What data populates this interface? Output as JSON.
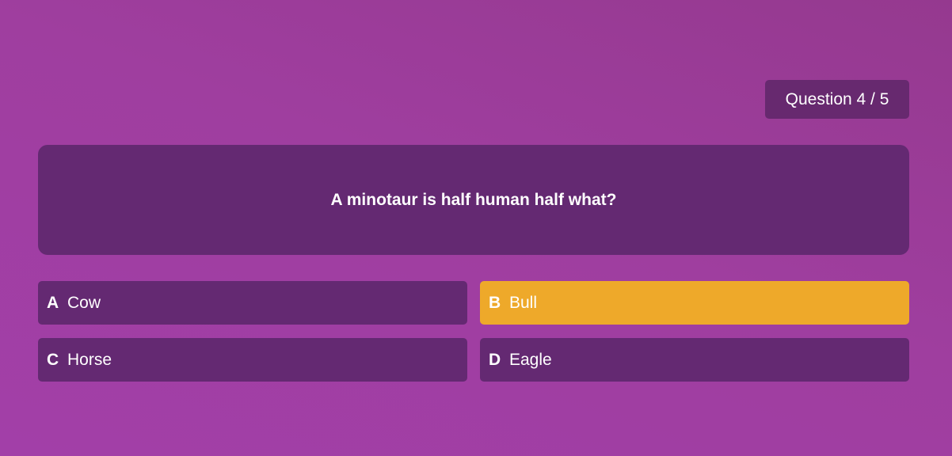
{
  "counter": {
    "label": "Question 4 / 5"
  },
  "question": {
    "text": "A minotaur is half human half what?"
  },
  "answers": [
    {
      "letter": "A",
      "text": "Cow",
      "selected": false
    },
    {
      "letter": "B",
      "text": "Bull",
      "selected": true
    },
    {
      "letter": "C",
      "text": "Horse",
      "selected": false
    },
    {
      "letter": "D",
      "text": "Eagle",
      "selected": false
    }
  ],
  "colors": {
    "card": "#642972",
    "selected": "#eea92a",
    "text": "#ffffff"
  }
}
